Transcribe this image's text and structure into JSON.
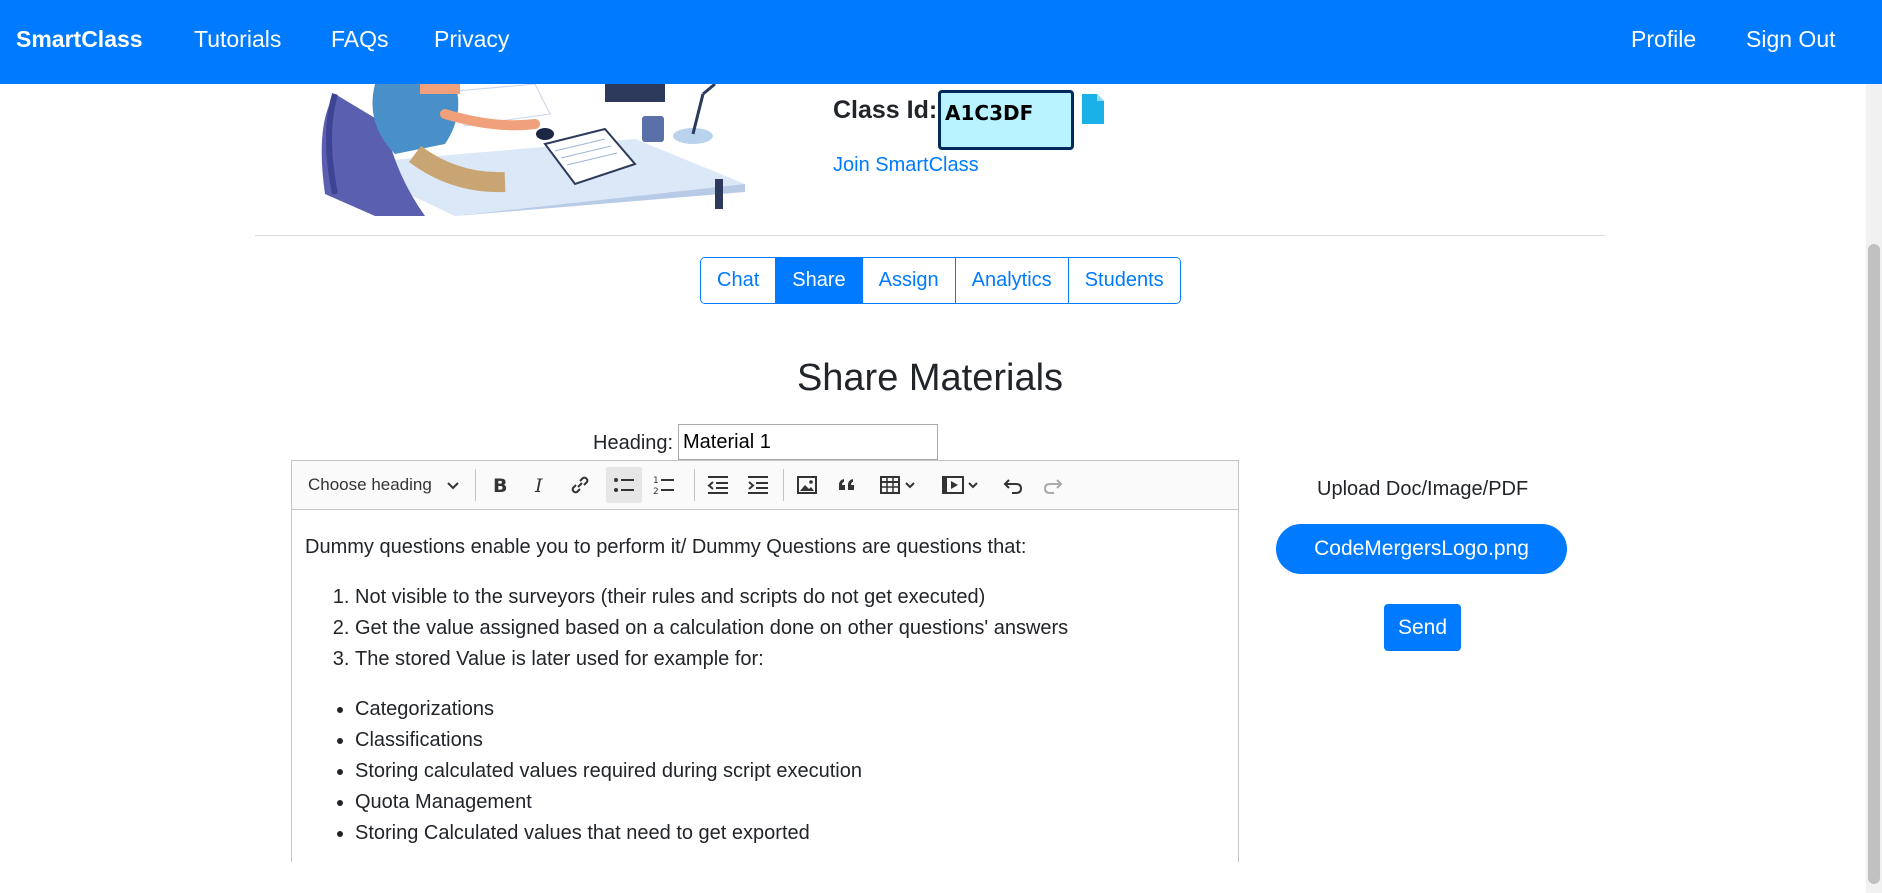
{
  "navbar": {
    "brand": "SmartClass",
    "links": [
      "Tutorials",
      "FAQs",
      "Privacy"
    ],
    "right_links": [
      "Profile",
      "Sign Out"
    ]
  },
  "class_info": {
    "label": "Class Id:",
    "id_value": "A1C3DF",
    "join_link": "Join SmartClass"
  },
  "tabs": [
    {
      "label": "Chat",
      "active": false
    },
    {
      "label": "Share",
      "active": true
    },
    {
      "label": "Assign",
      "active": false
    },
    {
      "label": "Analytics",
      "active": false
    },
    {
      "label": "Students",
      "active": false
    }
  ],
  "share": {
    "title": "Share Materials",
    "heading_label": "Heading:",
    "heading_value": "Material 1"
  },
  "editor": {
    "heading_select": "Choose heading",
    "toolbar_icons": [
      "bold-icon",
      "italic-icon",
      "link-icon",
      "bulleted-list-icon",
      "numbered-list-icon",
      "outdent-icon",
      "indent-icon",
      "image-icon",
      "blockquote-icon",
      "table-icon",
      "media-icon",
      "undo-icon",
      "redo-icon"
    ],
    "intro": "Dummy questions enable you to perform it/ Dummy Questions are questions that:",
    "ordered_items": [
      "Not visible to the surveyors (their rules and scripts do not get executed)",
      "Get the value assigned based on a calculation done on other questions' answers",
      "The stored Value is later used for example for:"
    ],
    "bullet_items": [
      "Categorizations",
      "Classifications",
      "Storing calculated values required during script execution",
      "Quota Management",
      "Storing Calculated values that need to get exported"
    ]
  },
  "upload": {
    "label": "Upload Doc/Image/PDF",
    "file_name": "CodeMergersLogo.png",
    "send_label": "Send"
  },
  "colors": {
    "primary": "#007bff",
    "class_id_bg": "#b9f3ff"
  }
}
